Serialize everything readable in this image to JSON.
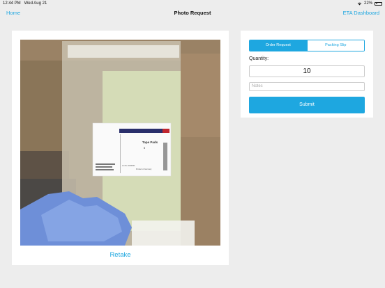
{
  "status_bar": {
    "time": "12:44 PM",
    "date": "Wed Aug 21",
    "battery": "22%",
    "icons": [
      "wifi-icon",
      "battery-icon"
    ]
  },
  "nav": {
    "back_label": "Home",
    "title": "Photo Request",
    "right_label": "ETA Dashboard"
  },
  "photo": {
    "label_title": "Tape Pads",
    "label_number": "5",
    "lot_text": "Lot No. 0000001",
    "origin_text": "Product of Germany"
  },
  "retake_label": "Retake",
  "form": {
    "tabs": [
      {
        "label": "Order Request",
        "active": true
      },
      {
        "label": "Packing Slip",
        "active": false
      }
    ],
    "quantity_label": "Quantity:",
    "quantity_value": "10",
    "notes_placeholder": "Notes",
    "submit_label": "Submit"
  },
  "colors": {
    "accent": "#1ea7e0",
    "background": "#ededed",
    "card": "#ffffff"
  }
}
